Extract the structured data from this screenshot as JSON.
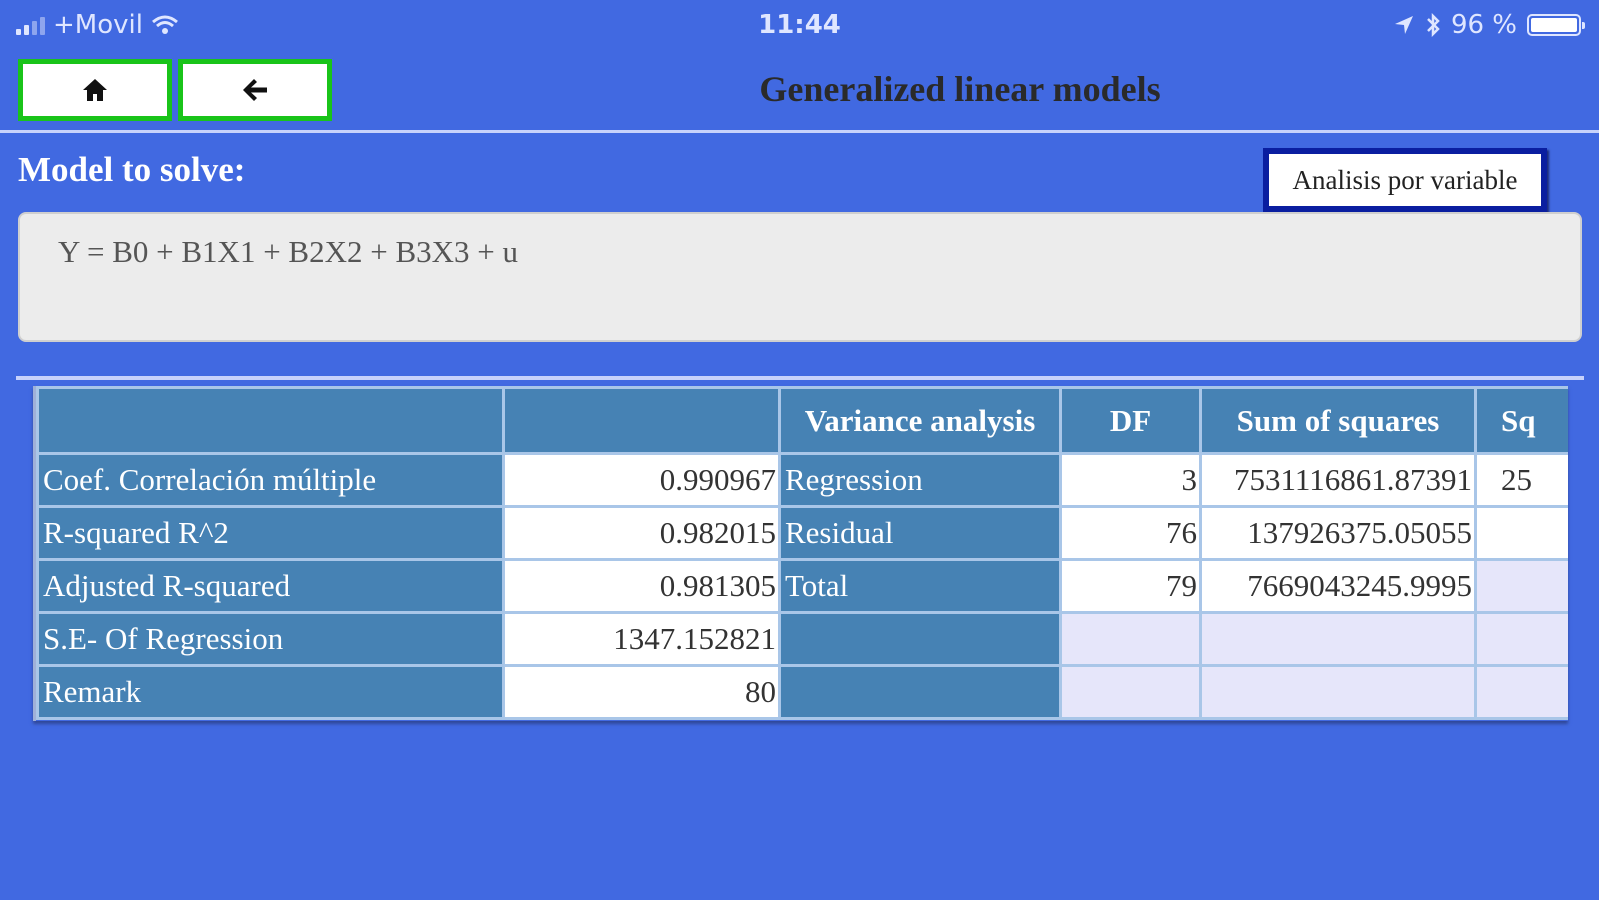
{
  "status_bar": {
    "carrier": "+Movil",
    "time": "11:44",
    "battery": "96 %"
  },
  "nav": {
    "home_icon": "home-icon",
    "back_icon": "arrow-left-icon"
  },
  "header": {
    "title": "Generalized linear models"
  },
  "model": {
    "label": "Model to solve:",
    "equation": "Y = B0 + B1X1 + B2X2 + B3X3 + u",
    "analisis_button": "Analisis por variable"
  },
  "table": {
    "headers": [
      "",
      "",
      "Variance analysis",
      "DF",
      "Sum of squares",
      "Sq"
    ],
    "rows": [
      {
        "stat": "Coef. Correlación múltiple",
        "value": "0.990967",
        "source": "Regression",
        "df": "3",
        "ss": "7531116861.87391",
        "extra": "25"
      },
      {
        "stat": "R-squared R^2",
        "value": "0.982015",
        "source": "Residual",
        "df": "76",
        "ss": "137926375.05055",
        "extra": ""
      },
      {
        "stat": "Adjusted R-squared",
        "value": "0.981305",
        "source": "Total",
        "df": "79",
        "ss": "7669043245.9995",
        "extra": ""
      },
      {
        "stat": "S.E- Of Regression",
        "value": "1347.152821",
        "source": "",
        "df": "",
        "ss": "",
        "extra": ""
      },
      {
        "stat": "Remark",
        "value": "80",
        "source": "",
        "df": "",
        "ss": "",
        "extra": ""
      }
    ]
  }
}
